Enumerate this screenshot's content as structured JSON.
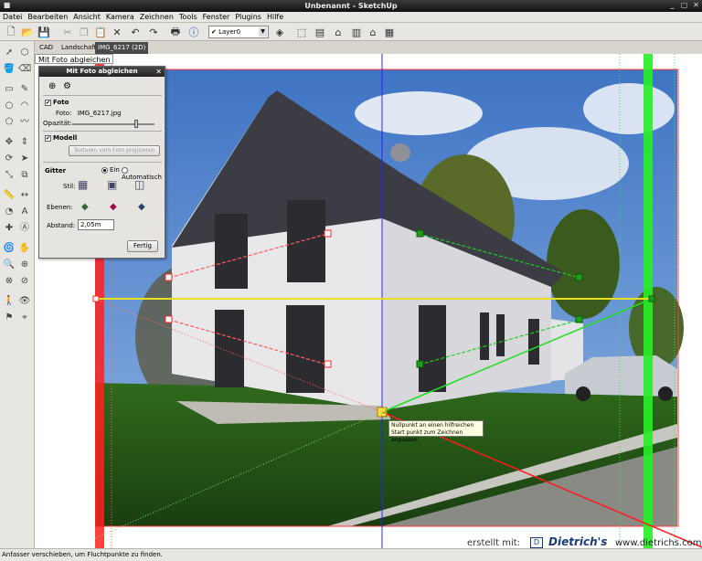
{
  "window": {
    "title": "Unbenannt - SketchUp"
  },
  "menu": [
    "Datei",
    "Bearbeiten",
    "Ansicht",
    "Kamera",
    "Zeichnen",
    "Tools",
    "Fenster",
    "Plugins",
    "Hilfe"
  ],
  "toolbar": {
    "layer_value": "Layer0"
  },
  "scene_tabs": [
    {
      "label": "CAD",
      "active": false
    },
    {
      "label": "Landschaft",
      "active": false
    },
    {
      "label": "IMG_6217 (2D)",
      "active": true
    }
  ],
  "panel_label": "Mit Foto abgleichen",
  "dialog": {
    "title": "Mit Foto abgleichen",
    "foto_section": "Foto",
    "foto_label": "Foto:",
    "foto_value": "IMG_6217.jpg",
    "opacity_label": "Opazität:",
    "opacity_value": 0.78,
    "modell_section": "Modell",
    "project_button": "Texturen vom Foto projizieren",
    "grid_section": "Gitter",
    "grid_on_label": "Ein",
    "grid_auto_label": "Automatisch",
    "style_label": "Stil:",
    "planes_label": "Ebenen:",
    "spacing_label": "Abstand:",
    "spacing_value": "2,05m",
    "done_button": "Fertig"
  },
  "tooltip": "Nullpunkt an einen hilfreichen Start punkt zum Zeichnen anpassen.",
  "status": "Anfasser verschieben, um Fluchtpunkte zu finden.",
  "credits": {
    "prefix": "erstellt mit:",
    "brand": "Dietrich's",
    "url": "www.dietrichs.com"
  },
  "colors": {
    "axis_red": "#ff2020",
    "axis_green": "#22dd22",
    "axis_blue": "#2222ff",
    "horizon": "#e8e020",
    "dark_chrome": "#222222"
  },
  "icons": {
    "toolbar": [
      "new-icon",
      "open-icon",
      "save-icon",
      "cut-icon",
      "copy-icon",
      "paste-icon",
      "delete-icon",
      "undo-icon",
      "redo-icon",
      "print-icon",
      "info-icon"
    ],
    "tools": [
      "select-icon",
      "eraser-icon",
      "paint-icon",
      "rectangle-icon",
      "line-icon",
      "circle-icon",
      "arc-icon",
      "polygon-icon",
      "freehand-icon"
    ]
  }
}
